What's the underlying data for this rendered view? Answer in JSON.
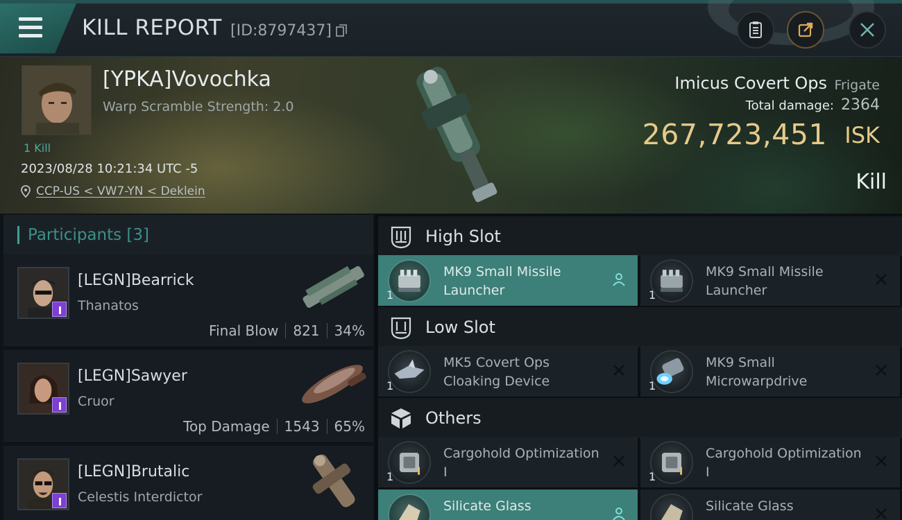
{
  "header": {
    "title": "KILL REPORT",
    "report_id": "[ID:8797437]"
  },
  "victim": {
    "name": "[YPKA]Vovochka",
    "warp_scramble": "Warp Scramble Strength: 2.0",
    "kills": "1 Kill",
    "datetime": "2023/08/28 10:21:34 UTC -5",
    "location": "CCP-US < VW7-YN < Deklein",
    "ship_name": "Imicus Covert Ops",
    "ship_class": "Frigate",
    "total_damage_label": "Total damage:",
    "total_damage": "2364",
    "isk_value": "267,723,451",
    "isk_unit": "ISK",
    "result": "Kill"
  },
  "participants": {
    "heading": "Participants [3]",
    "items": [
      {
        "name": "[LEGN]Bearrick",
        "ship": "Thanatos",
        "role": "Final Blow",
        "damage": "821",
        "percent": "34%"
      },
      {
        "name": "[LEGN]Sawyer",
        "ship": "Cruor",
        "role": "Top Damage",
        "damage": "1543",
        "percent": "65%"
      },
      {
        "name": "[LEGN]Brutalic",
        "ship": "Celestis Interdictor",
        "role": "",
        "damage": "",
        "percent": ""
      }
    ]
  },
  "fitting": {
    "high_slot": {
      "title": "High Slot",
      "modules": [
        {
          "qty": "1",
          "name": "MK9 Small Missile Launcher",
          "state": "dropped"
        },
        {
          "qty": "1",
          "name": "MK9 Small Missile Launcher",
          "state": "destroyed"
        }
      ]
    },
    "low_slot": {
      "title": "Low Slot",
      "modules": [
        {
          "qty": "1",
          "name": "MK5 Covert Ops Cloaking Device",
          "state": "destroyed"
        },
        {
          "qty": "1",
          "name": "MK9 Small Microwarpdrive",
          "state": "destroyed"
        }
      ]
    },
    "others": {
      "title": "Others",
      "modules": [
        {
          "qty": "1",
          "name": "Cargohold Optimization I",
          "state": "destroyed"
        },
        {
          "qty": "1",
          "name": "Cargohold Optimization I",
          "state": "destroyed"
        },
        {
          "qty": "",
          "name": "Silicate Glass",
          "state": "dropped"
        },
        {
          "qty": "",
          "name": "Silicate Glass",
          "state": "destroyed"
        }
      ]
    }
  },
  "colors": {
    "accent": "#3d7f79",
    "isk_gold": "#e7c98a",
    "tag_purple": "#7d3fd4"
  }
}
